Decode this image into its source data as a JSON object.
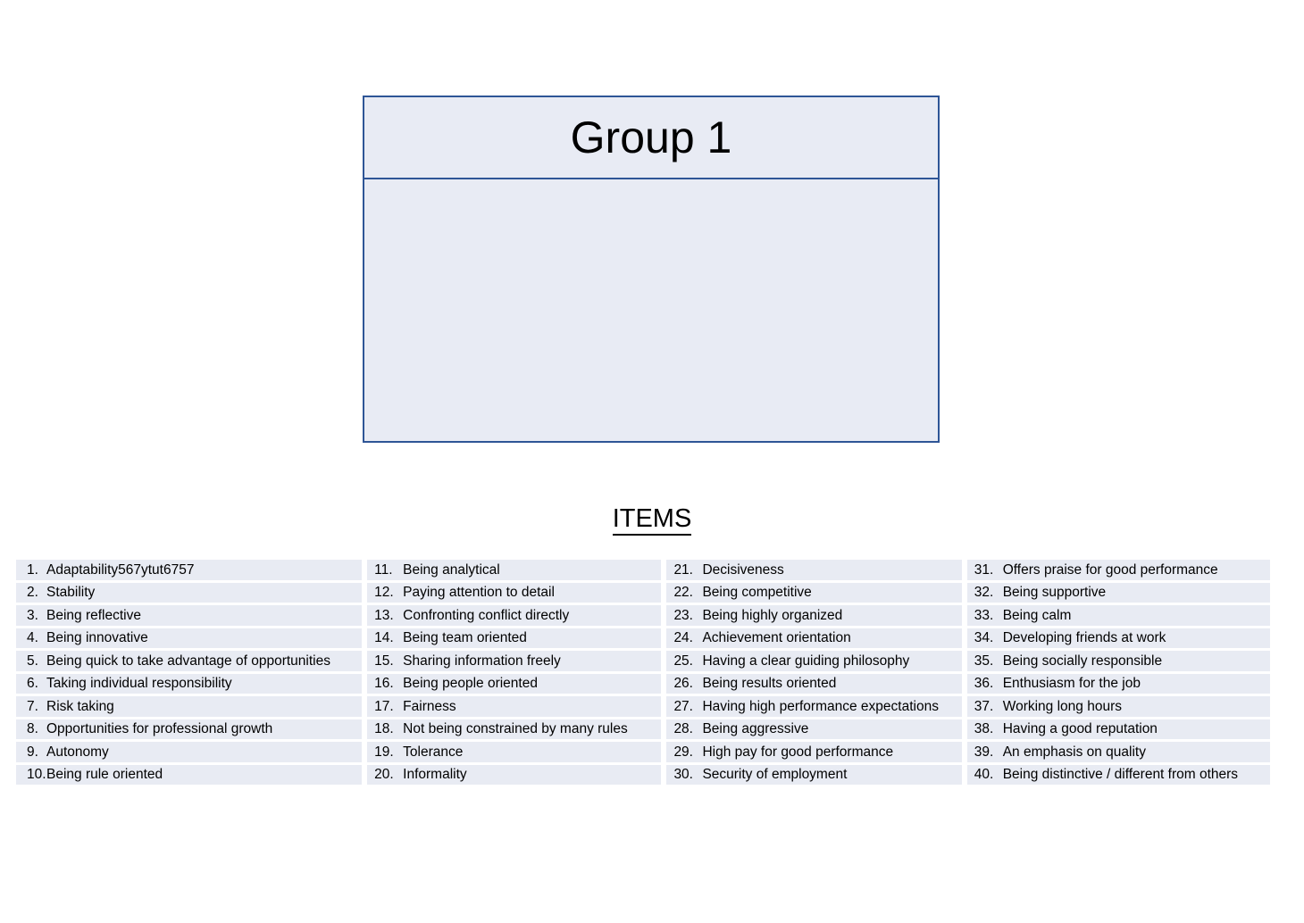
{
  "group_box": {
    "title": "Group 1",
    "body_text": "",
    "border_color": "#2E5596",
    "fill_color": "#E8EBF4"
  },
  "items_section": {
    "heading": "ITEMS",
    "row_fill_color": "#E8EBF3",
    "columns": [
      {
        "items": [
          {
            "number": "1.",
            "label": "Adaptability567ytut6757"
          },
          {
            "number": "2.",
            "label": "Stability"
          },
          {
            "number": "3.",
            "label": "Being reflective"
          },
          {
            "number": "4.",
            "label": "Being innovative"
          },
          {
            "number": "5.",
            "label": "Being quick to take advantage of opportunities"
          },
          {
            "number": "6.",
            "label": "Taking individual responsibility"
          },
          {
            "number": "7.",
            "label": "Risk taking"
          },
          {
            "number": "8.",
            "label": "Opportunities for professional growth"
          },
          {
            "number": "9.",
            "label": "Autonomy"
          },
          {
            "number": "10.",
            "label": "Being rule oriented"
          }
        ]
      },
      {
        "items": [
          {
            "number": "11.",
            "label": "Being analytical"
          },
          {
            "number": "12.",
            "label": "Paying attention to detail"
          },
          {
            "number": "13.",
            "label": "Confronting conflict directly"
          },
          {
            "number": "14.",
            "label": "Being team oriented"
          },
          {
            "number": "15.",
            "label": "Sharing information freely"
          },
          {
            "number": "16.",
            "label": "Being people oriented"
          },
          {
            "number": "17.",
            "label": "Fairness"
          },
          {
            "number": "18.",
            "label": "Not being constrained by many rules"
          },
          {
            "number": "19.",
            "label": "Tolerance"
          },
          {
            "number": "20.",
            "label": "Informality"
          }
        ]
      },
      {
        "items": [
          {
            "number": "21.",
            "label": "Decisiveness"
          },
          {
            "number": "22.",
            "label": "Being competitive"
          },
          {
            "number": "23.",
            "label": "Being highly organized"
          },
          {
            "number": "24.",
            "label": "Achievement orientation"
          },
          {
            "number": "25.",
            "label": "Having a clear guiding philosophy"
          },
          {
            "number": "26.",
            "label": "Being results oriented"
          },
          {
            "number": "27.",
            "label": "Having high performance expectations"
          },
          {
            "number": "28.",
            "label": "Being aggressive"
          },
          {
            "number": "29.",
            "label": "High pay for good performance"
          },
          {
            "number": "30.",
            "label": "Security of employment"
          }
        ]
      },
      {
        "items": [
          {
            "number": "31.",
            "label": "Offers praise for good performance"
          },
          {
            "number": "32.",
            "label": "Being supportive"
          },
          {
            "number": "33.",
            "label": "Being calm"
          },
          {
            "number": "34.",
            "label": "Developing friends at work"
          },
          {
            "number": "35.",
            "label": "Being socially responsible"
          },
          {
            "number": "36.",
            "label": "Enthusiasm for the job"
          },
          {
            "number": "37.",
            "label": "Working long hours"
          },
          {
            "number": "38.",
            "label": "Having a good reputation"
          },
          {
            "number": "39.",
            "label": "An emphasis on quality"
          },
          {
            "number": "40.",
            "label": "Being distinctive / different from others"
          }
        ]
      }
    ]
  }
}
